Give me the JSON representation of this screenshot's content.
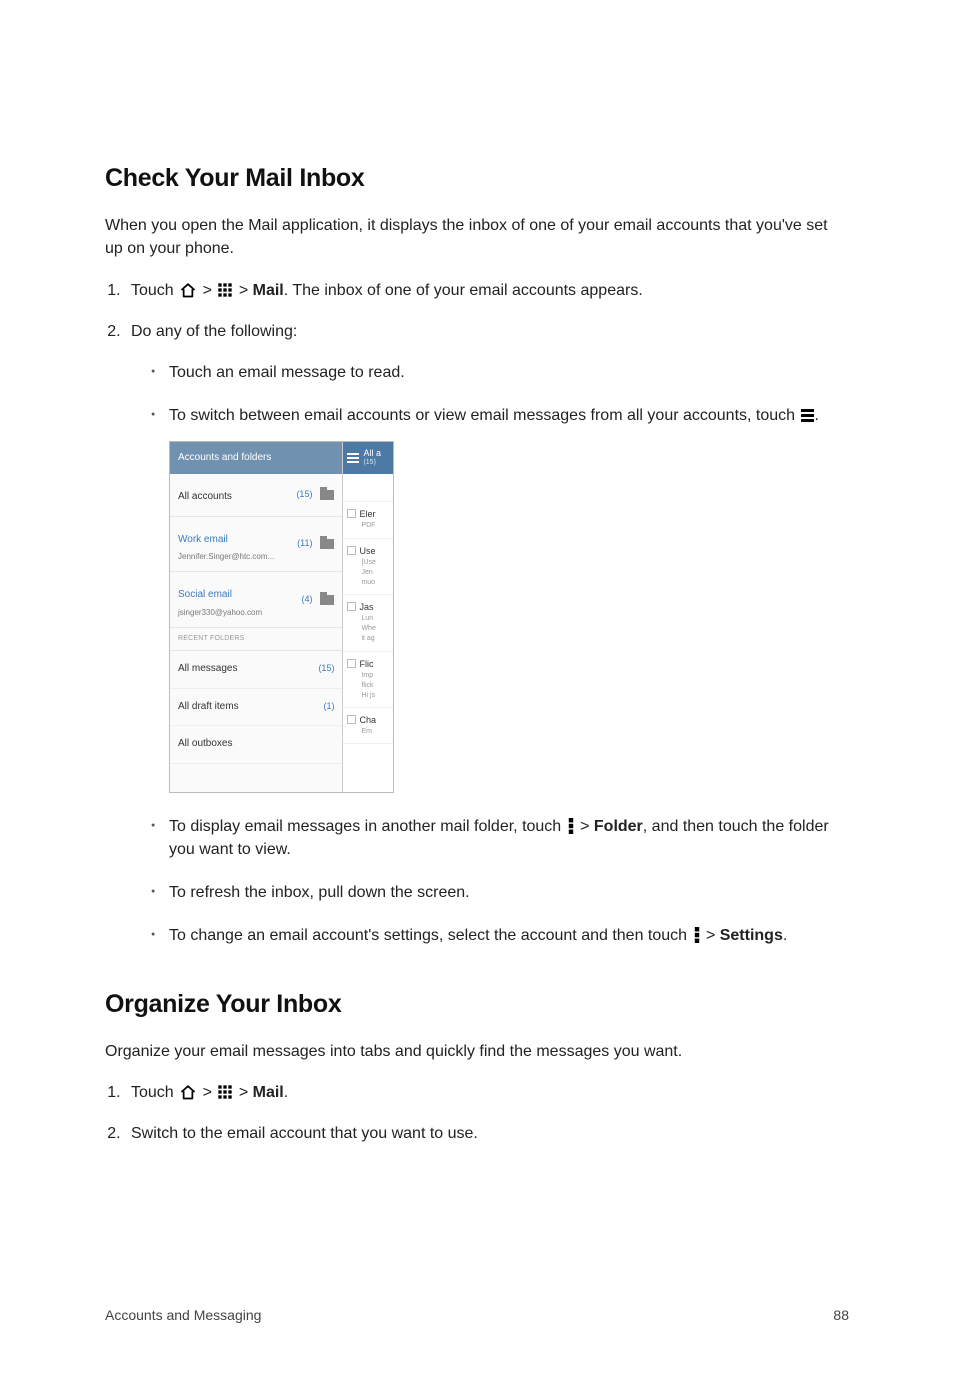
{
  "headings": {
    "h1a": "Check Your Mail Inbox",
    "h1b": "Organize Your Inbox"
  },
  "paras": {
    "intro": "When you open the Mail application, it displays the inbox of one of your email accounts that you've set up on your phone.",
    "organize_intro": "Organize your email messages into tabs and quickly find the messages you want."
  },
  "steps_a": {
    "s1_pre": "Touch ",
    "s1_mid": " > ",
    "s1_mail": "Mail",
    "s1_post": ". The inbox of one of your email accounts appears.",
    "s2": "Do any of the following:"
  },
  "bullets_a": {
    "b1": "Touch an email message to read.",
    "b2_pre": "To switch between email accounts or view email messages from all your accounts, touch ",
    "b2_post": ".",
    "b3_pre": "To display email messages in another mail folder, touch ",
    "b3_mid": " > ",
    "b3_bold": "Folder",
    "b3_post": ", and then touch the folder you want to view.",
    "b4": "To refresh the inbox, pull down the screen.",
    "b5_pre": "To change an email account's settings, select the account and then touch ",
    "b5_mid": " > ",
    "b5_bold": "Settings",
    "b5_post": "."
  },
  "steps_b": {
    "s1_pre": "Touch ",
    "s1_mid": " > ",
    "s1_mail": "Mail",
    "s1_post": ".",
    "s2": "Switch to the email account that you want to use."
  },
  "mock": {
    "left_header": "Accounts and folders",
    "right_header": {
      "title": "All a",
      "sub": "(15)"
    },
    "accounts": [
      {
        "name": "All accounts",
        "sub": "",
        "count": "(15)",
        "folder": true,
        "blue": false
      },
      {
        "name": "Work email",
        "sub": "Jennifer.Singer@htc.com...",
        "count": "(11)",
        "folder": true,
        "blue": true
      },
      {
        "name": "Social email",
        "sub": "jsinger330@yahoo.com",
        "count": "(4)",
        "folder": true,
        "blue": true
      }
    ],
    "recent_label": "RECENT FOLDERS",
    "folders": [
      {
        "name": "All messages",
        "count": "(15)"
      },
      {
        "name": "All draft items",
        "count": "(1)"
      },
      {
        "name": "All outboxes",
        "count": ""
      }
    ],
    "messages": [
      {
        "title": "Eler",
        "lines": [
          "PDF"
        ]
      },
      {
        "title": "Use",
        "lines": [
          "[Use",
          "Jen",
          "muo"
        ]
      },
      {
        "title": "Jas",
        "lines": [
          "Lun",
          "Whe",
          "it ag"
        ]
      },
      {
        "title": "Flic",
        "lines": [
          "Imp",
          "flick",
          "Hi js"
        ]
      },
      {
        "title": "Cha",
        "lines": [
          "Em"
        ]
      }
    ]
  },
  "footer": {
    "left": "Accounts and Messaging",
    "right": "88"
  }
}
